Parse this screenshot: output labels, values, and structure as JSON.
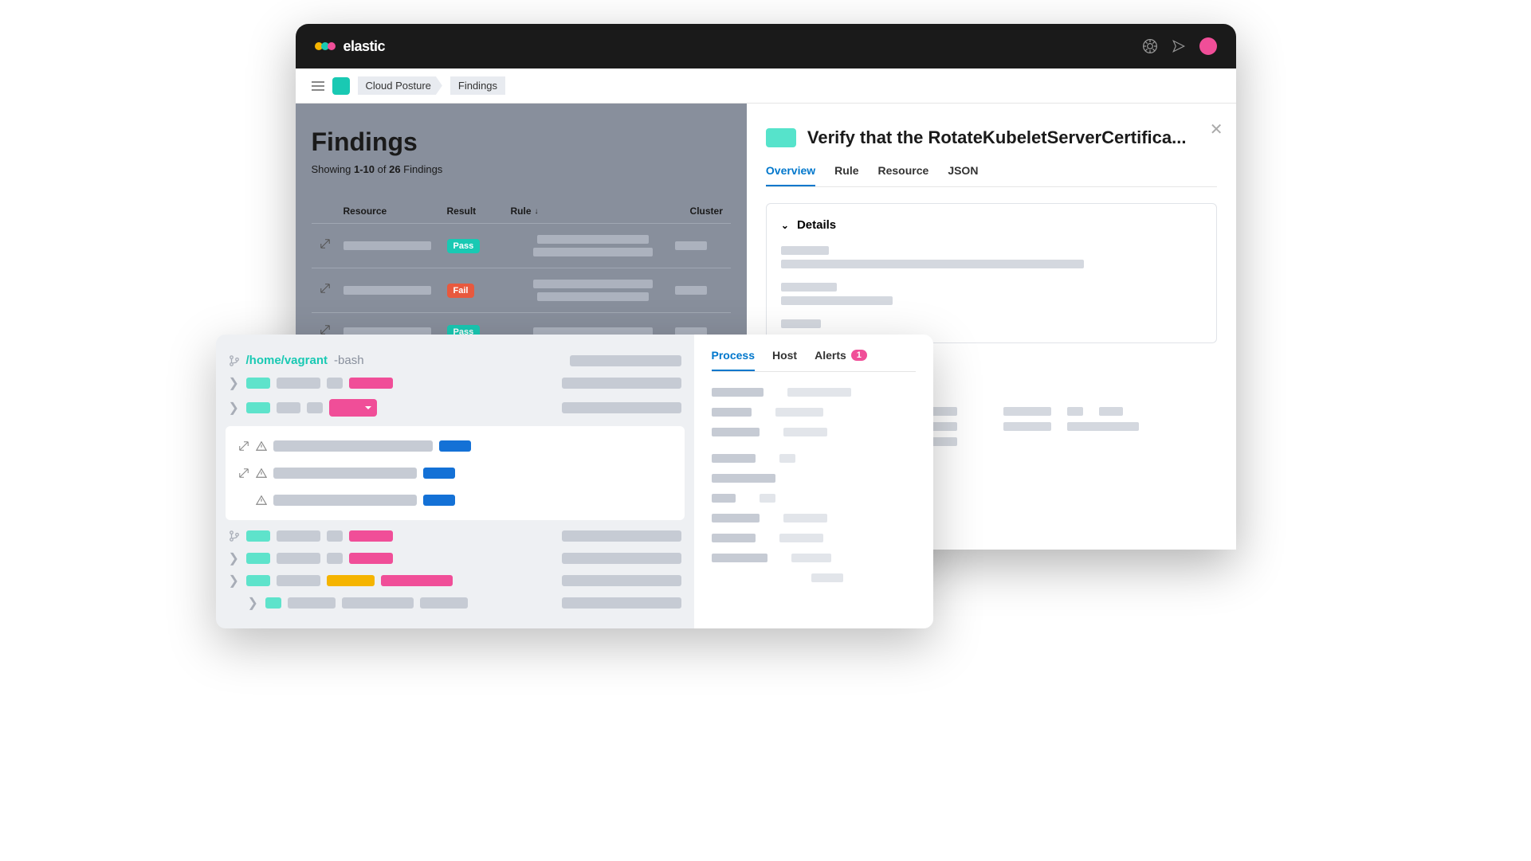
{
  "brand": "elastic",
  "breadcrumbs": [
    "Cloud Posture",
    "Findings"
  ],
  "findings": {
    "title": "Findings",
    "subtitle_prefix": "Showing ",
    "subtitle_range": "1-10",
    "subtitle_mid": " of ",
    "subtitle_total": "26",
    "subtitle_suffix": " Findings",
    "columns": {
      "resource": "Resource",
      "result": "Result",
      "rule": "Rule",
      "cluster": "Cluster"
    },
    "rows": [
      {
        "result": "Pass",
        "result_type": "pass"
      },
      {
        "result": "Fail",
        "result_type": "fail"
      },
      {
        "result": "Pass",
        "result_type": "pass"
      }
    ]
  },
  "detail": {
    "title": "Verify that the RotateKubeletServerCertifica...",
    "tabs": [
      "Overview",
      "Rule",
      "Resource",
      "JSON"
    ],
    "active_tab": "Overview",
    "section_header": "Details"
  },
  "terminal": {
    "path": "/home/vagrant",
    "shell": "-bash"
  },
  "overlay": {
    "tabs": {
      "process": "Process",
      "host": "Host",
      "alerts": "Alerts"
    },
    "active_tab": "Process",
    "alert_count": "1"
  }
}
